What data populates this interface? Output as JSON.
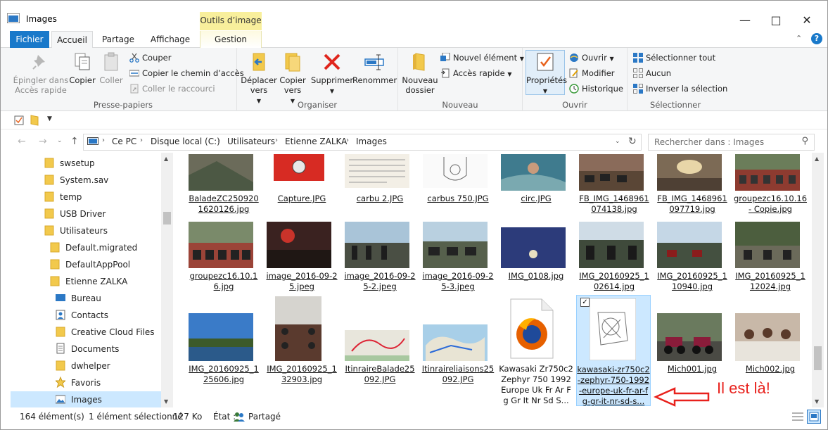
{
  "window": {
    "title": "Images"
  },
  "ribbon_tabs": {
    "file": "Fichier",
    "home": "Accueil",
    "share": "Partage",
    "view": "Affichage",
    "context_group": "Outils d’image",
    "context_tab": "Gestion"
  },
  "ribbon": {
    "clipboard": {
      "label": "Presse-papiers",
      "pin": "Épingler dans Accès rapide",
      "copy": "Copier",
      "paste": "Coller",
      "cut": "Couper",
      "copy_path": "Copier le chemin d’accès",
      "paste_shortcut": "Coller le raccourci"
    },
    "organize": {
      "label": "Organiser",
      "move": "Déplacer vers",
      "copy_to": "Copier vers",
      "delete": "Supprimer",
      "rename": "Renommer"
    },
    "new": {
      "label": "Nouveau",
      "new_folder": "Nouveau dossier",
      "new_item": "Nouvel élément",
      "easy_access": "Accès rapide"
    },
    "open": {
      "label": "Ouvrir",
      "properties": "Propriétés",
      "open": "Ouvrir",
      "edit": "Modifier",
      "history": "Historique"
    },
    "select": {
      "label": "Sélectionner",
      "select_all": "Sélectionner tout",
      "select_none": "Aucun",
      "invert": "Inverser la sélection"
    }
  },
  "address": {
    "crumbs": [
      "Ce PC",
      "Disque local (C:)",
      "Utilisateurs",
      "Etienne ZALKA",
      "Images"
    ],
    "search_placeholder": "Rechercher dans : Images"
  },
  "nav": [
    {
      "label": "swsetup",
      "icon": "folder-icon"
    },
    {
      "label": "System.sav",
      "icon": "folder-icon"
    },
    {
      "label": "temp",
      "icon": "folder-icon"
    },
    {
      "label": "USB Driver",
      "icon": "folder-icon"
    },
    {
      "label": "Utilisateurs",
      "icon": "folder-icon"
    },
    {
      "label": "Default.migrated",
      "icon": "folder-icon"
    },
    {
      "label": "DefaultAppPool",
      "icon": "folder-icon"
    },
    {
      "label": "Etienne ZALKA",
      "icon": "folder-icon"
    },
    {
      "label": "Bureau",
      "icon": "desktop-icon"
    },
    {
      "label": "Contacts",
      "icon": "contacts-icon"
    },
    {
      "label": "Creative Cloud Files",
      "icon": "folder-icon"
    },
    {
      "label": "Documents",
      "icon": "documents-icon"
    },
    {
      "label": "dwhelper",
      "icon": "folder-icon"
    },
    {
      "label": "Favoris",
      "icon": "star-icon"
    },
    {
      "label": "Images",
      "icon": "pictures-icon"
    }
  ],
  "files": {
    "row1": [
      "BaladeZC2509201620126.jpg",
      "Capture.JPG",
      "carbu 2.JPG",
      "carbus 750.JPG",
      "circ.JPG",
      "FB_IMG_1468961074138.jpg",
      "FB_IMG_1468961097719.jpg",
      "groupezc16.10.16 - Copie.jpg"
    ],
    "row2": [
      "groupezc16.10.16.jpg",
      "image_2016-09-25.jpeg",
      "image_2016-09-25-2.jpeg",
      "image_2016-09-25-3.jpeg",
      "IMG_0108.jpg",
      "IMG_20160925_102614.jpg",
      "IMG_20160925_110940.jpg",
      "IMG_20160925_112024.jpg"
    ],
    "row3": [
      "IMG_20160925_125606.jpg",
      "IMG_20160925_132903.jpg",
      "ItinraireBalade25092.JPG",
      "Itinraireliaisons25092.JPG",
      "Kawasaki Zr750c2 Zephyr 750 1992 Europe Uk Fr Ar Fg Gr It Nr Sd S...",
      "kawasaki-zr750c2-zephyr-750-1992-europe-uk-fr-ar-fg-gr-it-nr-sd-s...",
      "Mich001.jpg",
      "Mich002.jpg"
    ]
  },
  "status": {
    "count": "164 élément(s)",
    "selected": "1 élément sélectionné",
    "size": "127 Ko",
    "state_label": "État :",
    "state_value": "Partagé"
  },
  "annotation": {
    "text": "Il est là!"
  },
  "colors": {
    "accent": "#1979ca",
    "selection": "#cce8ff",
    "annotation": "#e8211c",
    "context_tab": "#f8ef9c"
  }
}
